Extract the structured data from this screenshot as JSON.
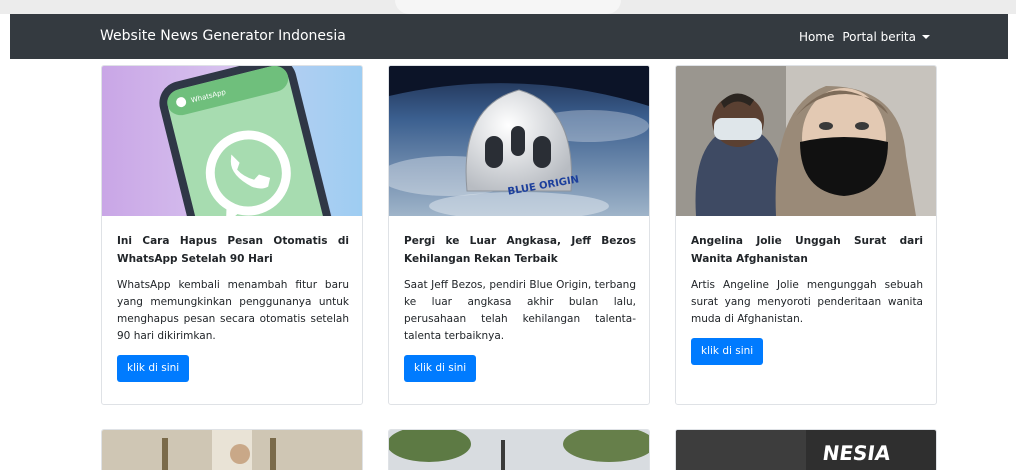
{
  "navbar": {
    "brand": "Website News Generator Indonesia",
    "home": "Home",
    "portal": "Portal berita"
  },
  "cards": [
    {
      "title": "Ini Cara Hapus Pesan Otomatis di WhatsApp Setelah 90 Hari",
      "text": "WhatsApp kembali menambah fitur baru yang memungkinkan penggunanya untuk menghapus pesan secara otomatis setelah 90 hari dikirimkan.",
      "button": "klik di sini",
      "image_caption": "WhatsApp"
    },
    {
      "title": "Pergi ke Luar Angkasa, Jeff Bezos Kehilangan Rekan Terbaik",
      "text": "Saat Jeff Bezos, pendiri Blue Origin, terbang ke luar angkasa akhir bulan lalu, perusahaan telah kehilangan talenta-talenta terbaiknya.",
      "button": "klik di sini",
      "image_caption": "BLUE ORIGIN"
    },
    {
      "title": "Angelina Jolie Unggah Surat dari Wanita Afghanistan",
      "text": "Artis Angeline Jolie mengunggah sebuah surat yang menyoroti penderitaan wanita muda di Afghanistan.",
      "button": "klik di sini"
    }
  ],
  "row2": {
    "partial_text": "NESIA"
  },
  "colors": {
    "navbar": "#343a40",
    "button": "#007bff",
    "whatsapp": "#25d366"
  }
}
